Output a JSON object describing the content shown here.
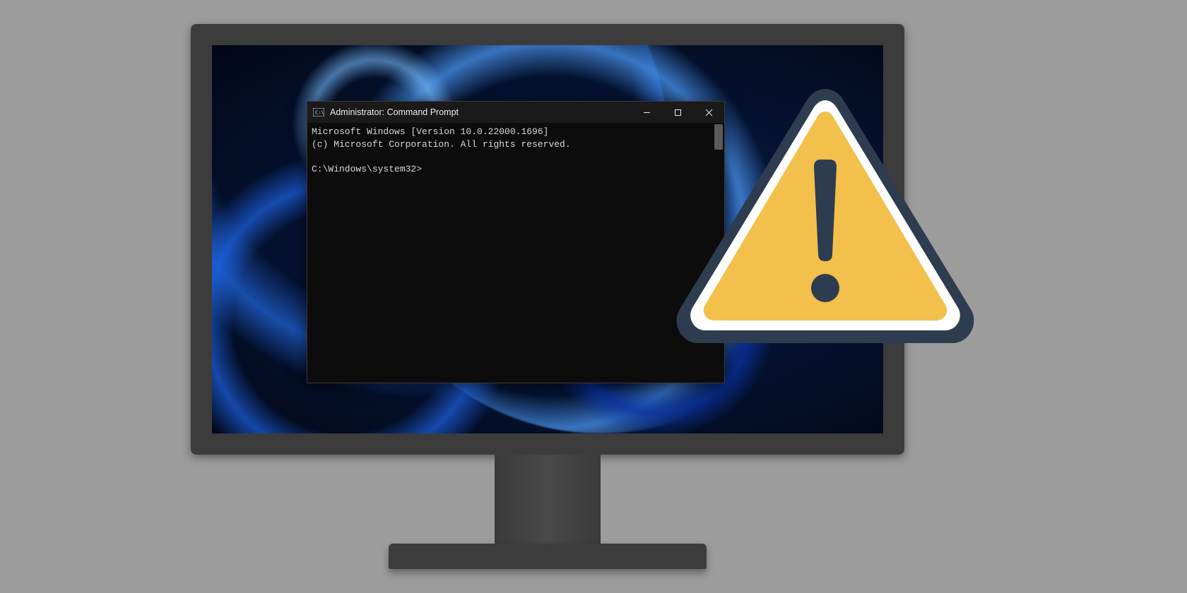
{
  "window": {
    "title": "Administrator: Command Prompt",
    "icon_name": "cmd-icon",
    "controls": {
      "minimize_name": "minimize-icon",
      "maximize_name": "maximize-icon",
      "close_name": "close-icon"
    }
  },
  "terminal": {
    "line1": "Microsoft Windows [Version 10.0.22000.1696]",
    "line2": "(c) Microsoft Corporation. All rights reserved.",
    "blank": "",
    "prompt": "C:\\Windows\\system32>"
  },
  "graphic": {
    "warning_icon_name": "warning-triangle-icon",
    "colors": {
      "triangle_fill": "#f3c04b",
      "triangle_border": "#2e3c4f",
      "triangle_inner_stroke": "#ffffff",
      "exclamation": "#2e3c4f"
    }
  }
}
